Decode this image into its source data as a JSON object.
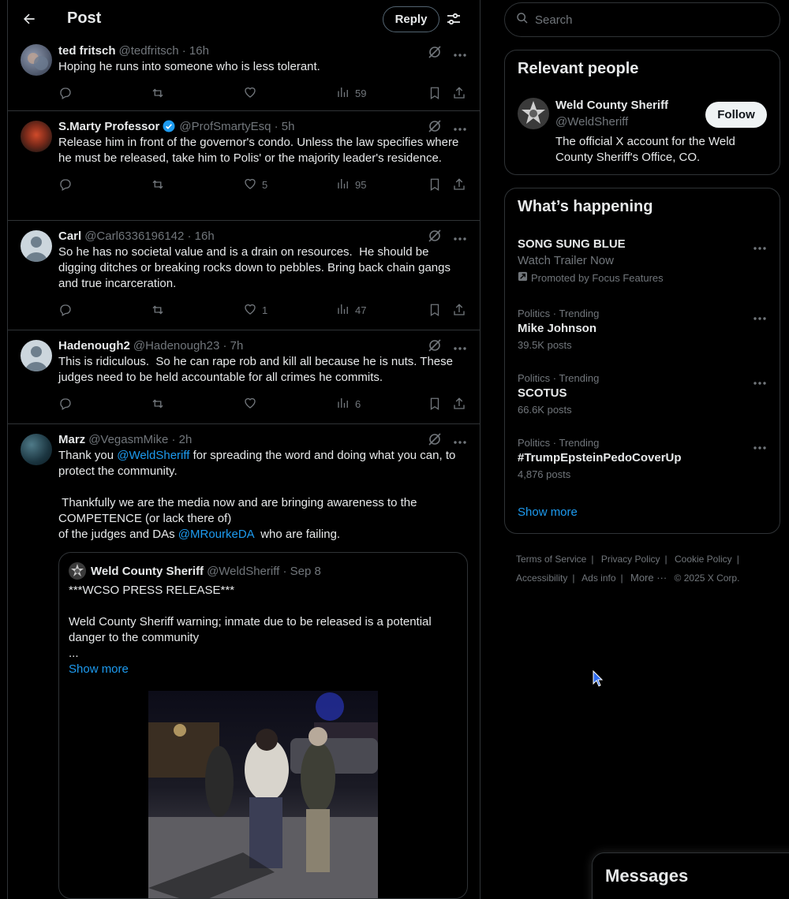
{
  "header": {
    "title": "Post",
    "reply_label": "Reply"
  },
  "tweets": [
    {
      "name": "ted fritsch",
      "handle": "@tedfritsch · 16h",
      "text": "Hoping he runs into someone who is less tolerant.",
      "likes": "",
      "views": "59"
    },
    {
      "name": "S.Marty Professor",
      "handle": "@ProfSmartyEsq · 5h",
      "text": "Release him in front of the governor's condo. Unless the law specifies where he must be released, take him to Polis' or the majority leader's residence.",
      "likes": "5",
      "views": "95"
    },
    {
      "name": "Carl",
      "handle": "@Carl6336196142 · 16h",
      "text": "So he has no societal value and is a drain on resources.  He should be digging ditches or breaking rocks down to pebbles. Bring back chain gangs and true incarceration.",
      "likes": "1",
      "views": "47"
    },
    {
      "name": "Hadenough2",
      "handle": "@Hadenough23 · 7h",
      "text": "This is ridiculous.  So he can rape rob and kill all because he is nuts. These judges need to be held accountable for all crimes he commits.",
      "likes": "",
      "views": "6"
    },
    {
      "name": "Marz",
      "handle": "@VegasmMike · 2h",
      "text_a": "Thank you ",
      "mention_a": "@WeldSheriff",
      "text_b": " for spreading the word and doing what you can, to protect the community.\n\n Thankfully we are the media now and are bringing awareness to the COMPETENCE (or lack there of)\nof the judges and DAs ",
      "mention_b": "@MRourkeDA",
      "text_c": "  who are failing."
    }
  ],
  "quote": {
    "name": "Weld County Sheriff",
    "handle": "@WeldSheriff · Sep 8",
    "text": "***WCSO PRESS RELEASE***\n\nWeld County Sheriff warning; inmate due to be released is a potential danger to the community\n...",
    "show_more": "Show more"
  },
  "search": {
    "placeholder": "Search"
  },
  "relevant": {
    "title": "Relevant people",
    "name": "Weld County Sheriff",
    "handle": "@WeldSheriff",
    "follow_label": "Follow",
    "bio": "The official X account for the Weld County Sheriff's Office, CO."
  },
  "happening": {
    "title": "What’s happening",
    "promo": {
      "title": "SONG SUNG BLUE",
      "sub": "Watch Trailer Now",
      "by": "Promoted by Focus Features"
    },
    "trends": [
      {
        "cat": "Politics · Trending",
        "title": "Mike Johnson",
        "count": "39.5K posts"
      },
      {
        "cat": "Politics · Trending",
        "title": "SCOTUS",
        "count": "66.6K posts"
      },
      {
        "cat": "Politics · Trending",
        "title": "#TrumpEpsteinPedoCoverUp",
        "count": "4,876 posts"
      }
    ],
    "show_more": "Show more"
  },
  "footer": {
    "terms": "Terms of Service",
    "privacy": "Privacy Policy",
    "cookie": "Cookie Policy",
    "access": "Accessibility",
    "ads": "Ads info",
    "more": "More ···",
    "copy": "© 2025 X Corp."
  },
  "messages": {
    "title": "Messages"
  },
  "colors": {
    "accent": "#1d9bf0",
    "bg": "#000000",
    "border": "#2f3336",
    "muted": "#71767b"
  }
}
